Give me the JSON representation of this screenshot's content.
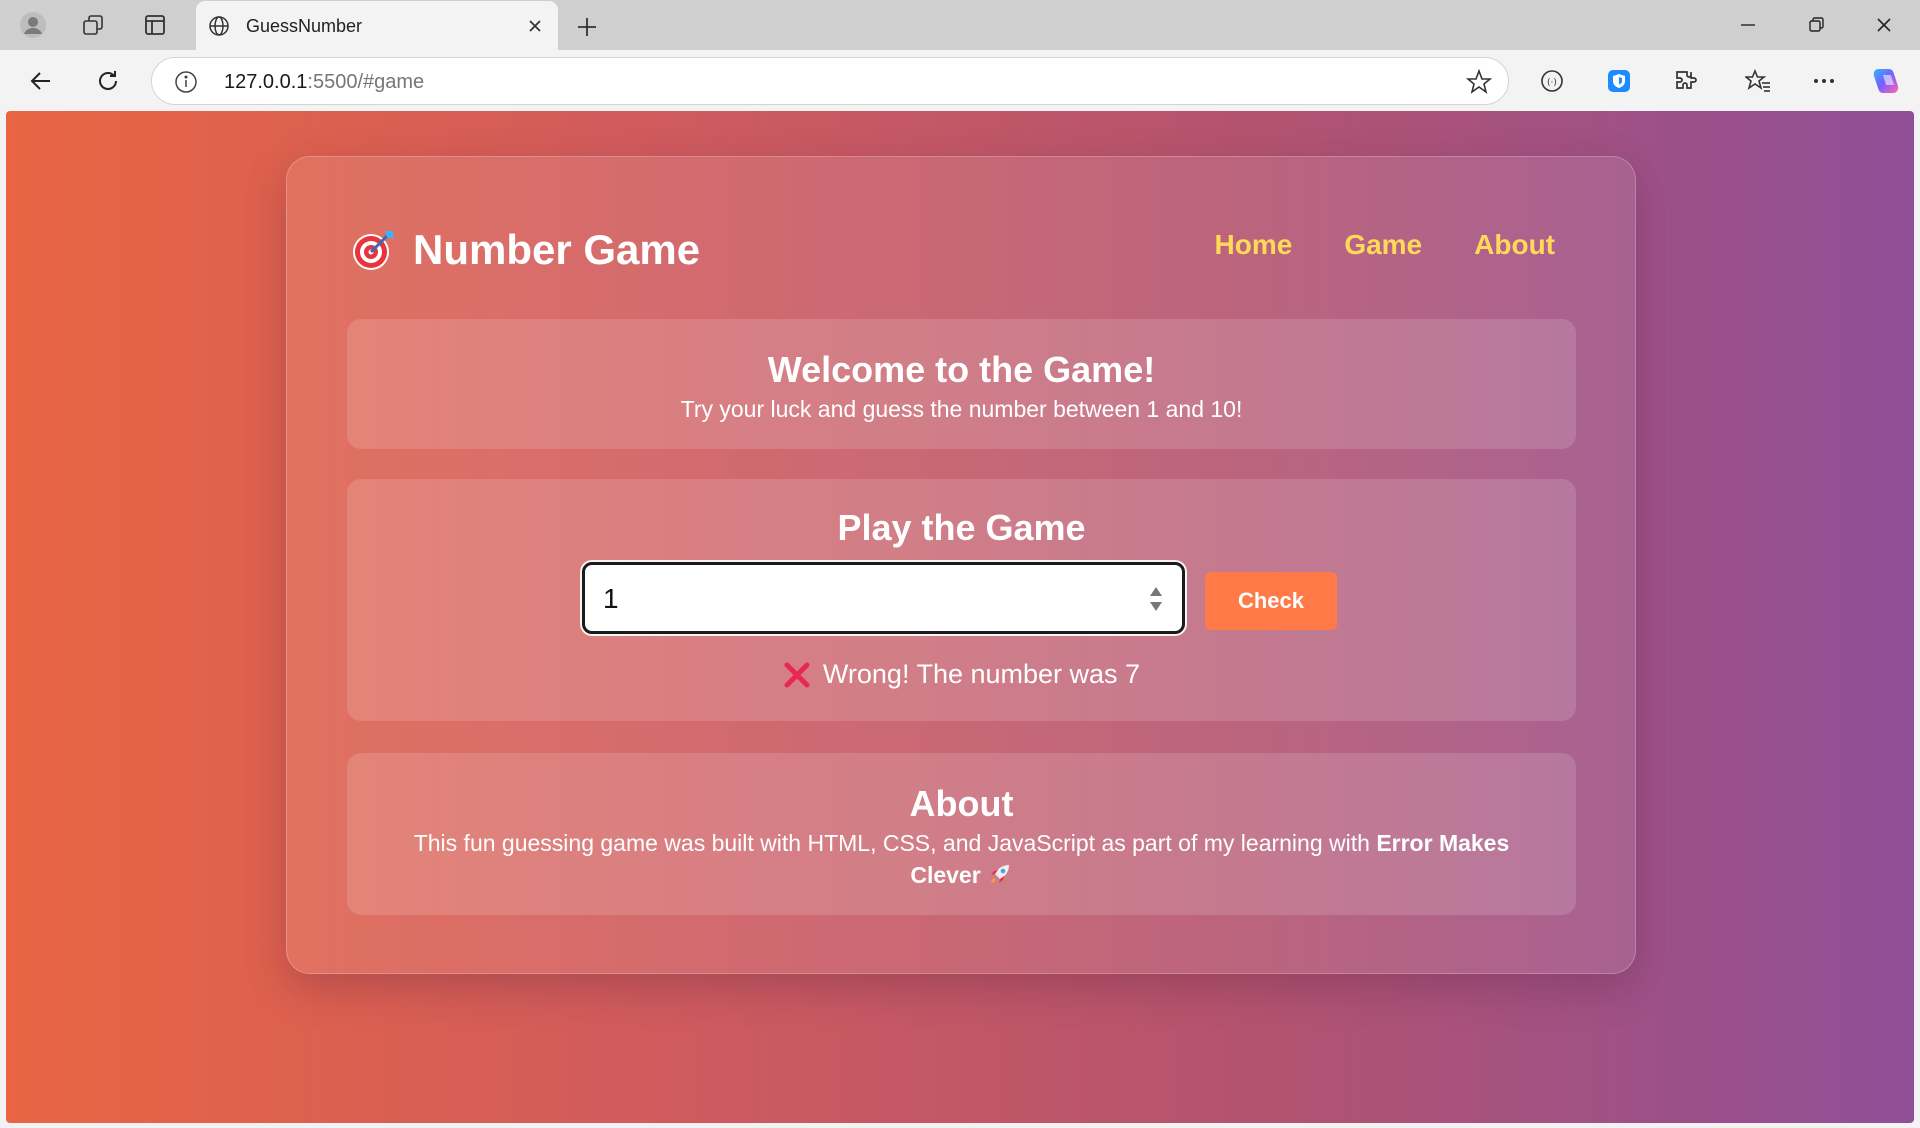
{
  "browser": {
    "tab_title": "GuessNumber",
    "address_host": "127.0.0.1",
    "address_path": ":5500/#game"
  },
  "site": {
    "brand_title": "Number Game",
    "nav": [
      "Home",
      "Game",
      "About"
    ]
  },
  "welcome": {
    "heading": "Welcome to the Game!",
    "text": "Try your luck and guess the number between 1 and 10!"
  },
  "play": {
    "heading": "Play the Game",
    "input_value": "1",
    "check_label": "Check",
    "result_text": "Wrong! The number was 7"
  },
  "about": {
    "heading": "About",
    "text_before": "This fun guessing game was built with HTML, CSS, and JavaScript as part of my learning with ",
    "text_bold": "Error Makes Clever"
  },
  "colors": {
    "accent_nav": "#ffd95a",
    "button": "#ff7a47",
    "gradient_start": "#e96543",
    "gradient_end": "#8f4f97"
  }
}
